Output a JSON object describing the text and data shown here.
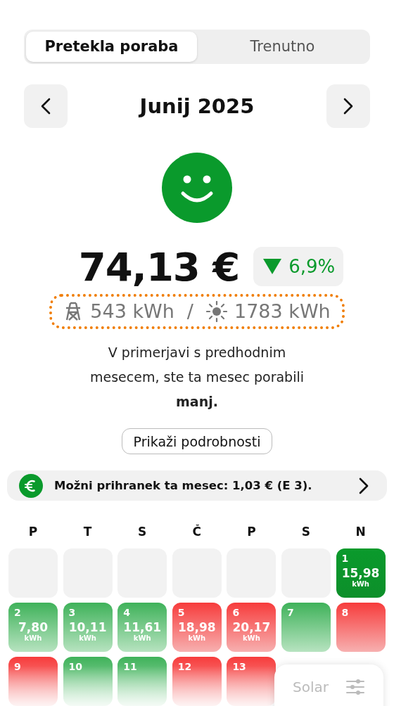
{
  "tabs": [
    {
      "label": "Pretekla poraba",
      "selected": true
    },
    {
      "label": "Trenutno",
      "selected": false
    }
  ],
  "period": {
    "title": "Junij 2025"
  },
  "summary": {
    "face": {
      "kind": "happy"
    },
    "amount": "74,13 €",
    "change": {
      "kind": "down",
      "value": "6,9%"
    },
    "grid_energy": "543 kWh",
    "separator": "/",
    "solar_energy": "1783 kWh",
    "comparison": "V primerjavi s predhodnim mesecem, ste ta mesec porabili **manj.**",
    "details_button": "Prikaži podrobnosti"
  },
  "savings": {
    "text": "Možni prihranek ta mesec: 1,03 € (E 3)."
  },
  "calendar": {
    "weekdays": [
      "P",
      "T",
      "S",
      "Č",
      "P",
      "S",
      "N"
    ],
    "days": [
      {
        "kind": "empty"
      },
      {
        "kind": "empty"
      },
      {
        "kind": "empty"
      },
      {
        "kind": "empty"
      },
      {
        "kind": "empty"
      },
      {
        "kind": "empty"
      },
      {
        "kind": "good-strong",
        "day": "1",
        "value": "15,98",
        "unit": "kWh"
      },
      {
        "kind": "good",
        "day": "2",
        "value": "7,80",
        "unit": "kWh"
      },
      {
        "kind": "good",
        "day": "3",
        "value": "10,11",
        "unit": "kWh"
      },
      {
        "kind": "good",
        "day": "4",
        "value": "11,61",
        "unit": "kWh"
      },
      {
        "kind": "bad",
        "day": "5",
        "value": "18,98",
        "unit": "kWh"
      },
      {
        "kind": "bad",
        "day": "6",
        "value": "20,17",
        "unit": "kWh"
      },
      {
        "kind": "good",
        "day": "7"
      },
      {
        "kind": "bad",
        "day": "8"
      },
      {
        "kind": "bad",
        "day": "9"
      },
      {
        "kind": "good",
        "day": "10"
      },
      {
        "kind": "good",
        "day": "11"
      },
      {
        "kind": "bad",
        "day": "12"
      },
      {
        "kind": "bad",
        "day": "13"
      }
    ]
  },
  "floating_button": {
    "label": "Solar"
  }
}
